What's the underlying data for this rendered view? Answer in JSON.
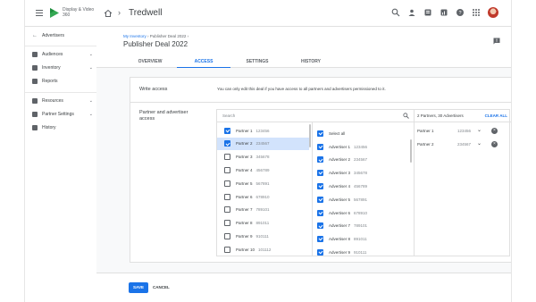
{
  "app": {
    "logo_text": "Display & Video 360",
    "title": "Tredwell"
  },
  "colors": {
    "accent": "#1a73e8",
    "selected_row": "#d2e3fc"
  },
  "topbar_icons": [
    "search-icon",
    "person-add-icon",
    "notifications-icon",
    "chart-icon",
    "help-icon",
    "apps-icon",
    "avatar"
  ],
  "sidebar": {
    "items": [
      {
        "label": "Advertisers",
        "icon": "arrow-back-icon"
      },
      {
        "label": "Audiences",
        "icon": "people-icon",
        "has_arrow": true
      },
      {
        "label": "Inventory",
        "icon": "inventory-icon",
        "has_arrow": true
      },
      {
        "label": "Reports",
        "icon": "reports-icon"
      },
      {
        "label": "Resources",
        "icon": "resources-icon",
        "has_arrow": true
      },
      {
        "label": "Partner Settings",
        "icon": "settings-icon",
        "has_arrow": true
      },
      {
        "label": "History",
        "icon": "history-icon"
      }
    ]
  },
  "header": {
    "breadcrumb": {
      "link": "My Inventory",
      "sep1": "›",
      "current": "Publisher Deal 2022",
      "sep2": "›"
    },
    "title": "Publisher Deal 2022",
    "tabs": [
      {
        "label": "OVERVIEW",
        "active": false
      },
      {
        "label": "ACCESS",
        "active": true
      },
      {
        "label": "SETTINGS",
        "active": false
      },
      {
        "label": "HISTORY",
        "active": false
      }
    ]
  },
  "write_access": {
    "label": "Write access",
    "text": "You can only edit this deal if you have access to all partners and advertisers permissioned to it."
  },
  "partner_access": {
    "label": "Partner and advertiser access",
    "search_placeholder": "Search",
    "partners": [
      {
        "name": "Partner 1",
        "id": "123456",
        "checked": true,
        "selected": false
      },
      {
        "name": "Partner 2",
        "id": "234567",
        "checked": true,
        "selected": true
      },
      {
        "name": "Partner 3",
        "id": "345678",
        "checked": false,
        "selected": false
      },
      {
        "name": "Partner 4",
        "id": "456789",
        "checked": false,
        "selected": false
      },
      {
        "name": "Partner 5",
        "id": "567891",
        "checked": false,
        "selected": false
      },
      {
        "name": "Partner 6",
        "id": "678910",
        "checked": false,
        "selected": false
      },
      {
        "name": "Partner 7",
        "id": "789101",
        "checked": false,
        "selected": false
      },
      {
        "name": "Partner 8",
        "id": "891011",
        "checked": false,
        "selected": false
      },
      {
        "name": "Partner 9",
        "id": "910111",
        "checked": false,
        "selected": false
      },
      {
        "name": "Partner 10",
        "id": "101112",
        "checked": false,
        "selected": false
      }
    ],
    "select_all_label": "Select all",
    "advertisers": [
      {
        "name": "Advertiser 1",
        "id": "123456"
      },
      {
        "name": "Advertiser 2",
        "id": "234567"
      },
      {
        "name": "Advertiser 3",
        "id": "345678"
      },
      {
        "name": "Advertiser 4",
        "id": "456789"
      },
      {
        "name": "Advertiser 5",
        "id": "567891"
      },
      {
        "name": "Advertiser 6",
        "id": "678910"
      },
      {
        "name": "Advertiser 7",
        "id": "789101"
      },
      {
        "name": "Advertiser 8",
        "id": "891011"
      },
      {
        "name": "Advertiser 9",
        "id": "910111"
      }
    ],
    "selection_summary": "2 Partners, 30 Advertisers",
    "clear_all_label": "CLEAR ALL",
    "selected": [
      {
        "name": "Partner 1",
        "id": "123456"
      },
      {
        "name": "Partner 2",
        "id": "234567"
      }
    ]
  },
  "footer": {
    "save_label": "SAVE",
    "cancel_label": "CANCEL"
  }
}
